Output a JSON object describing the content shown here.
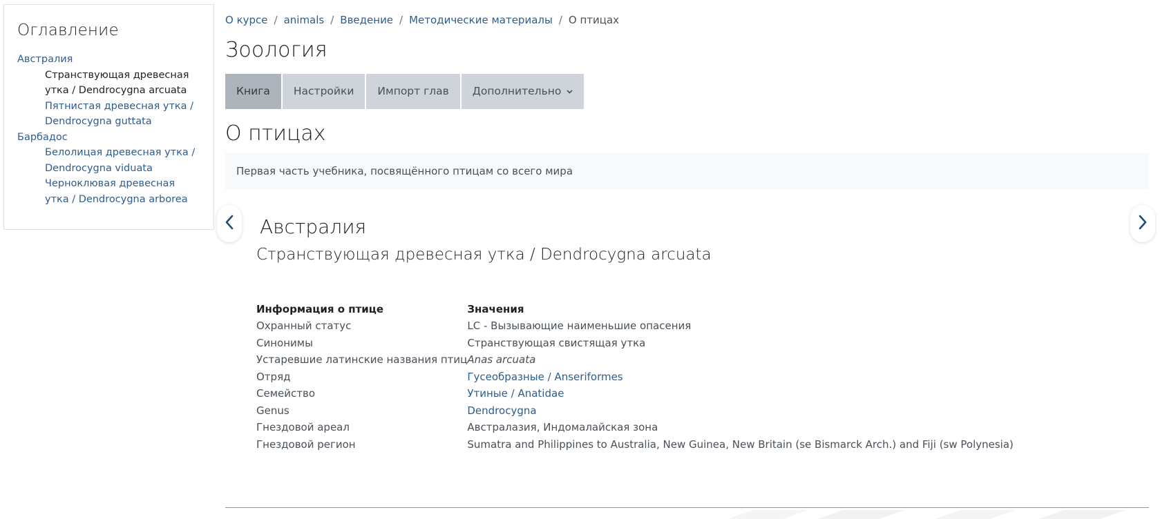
{
  "toc": {
    "title": "Оглавление",
    "chapters": [
      {
        "label": "Австралия",
        "subchapters": [
          {
            "label": "Странствующая древесная утка / Dendrocygna arcuata",
            "current": true
          },
          {
            "label": "Пятнистая древесная утка / Dendrocygna guttata",
            "current": false
          }
        ]
      },
      {
        "label": "Барбадос",
        "subchapters": [
          {
            "label": "Белолицая древесная утка / Dendrocygna viduata",
            "current": false
          },
          {
            "label": "Черноклювая древесная утка / Dendrocygna arborea",
            "current": false
          }
        ]
      }
    ]
  },
  "breadcrumb": [
    "О курсе",
    "animals",
    "Введение",
    "Методические материалы",
    "О птицах"
  ],
  "breadcrumb_separator": "/",
  "page_title": "Зоология",
  "tabs": [
    {
      "label": "Книга",
      "active": true
    },
    {
      "label": "Настройки",
      "active": false
    },
    {
      "label": "Импорт глав",
      "active": false
    },
    {
      "label": "Дополнительно",
      "active": false,
      "dropdown": true
    }
  ],
  "book": {
    "title": "О птицах",
    "intro": "Первая часть учебника, посвящённого птицам со всего мира"
  },
  "chapter": {
    "title": "Австралия",
    "subtitle": "Странствующая древесная утка / Dendrocygna arcuata"
  },
  "info_table": {
    "headers": [
      "Информация о птице",
      "Значения"
    ],
    "rows": [
      {
        "key": "Охранный статус",
        "value": "LC - Вызывающие наименьшие опасения",
        "link": false,
        "italic": false
      },
      {
        "key": "Синонимы",
        "value": "Странствующая свистящая утка",
        "link": false,
        "italic": false
      },
      {
        "key": "Устаревшие латинские названия птиц",
        "value": "Anas arcuata",
        "link": false,
        "italic": true
      },
      {
        "key": "Отряд",
        "value": "Гусеобразные / Anseriformes",
        "link": true,
        "italic": false
      },
      {
        "key": "Семейство",
        "value": "Утиные / Anatidae",
        "link": true,
        "italic": false
      },
      {
        "key": "Genus",
        "value": "Dendrocygna",
        "link": true,
        "italic": false
      },
      {
        "key": "Гнездовой ареал",
        "value": "Австралазия, Индомалайская зона",
        "link": false,
        "italic": false
      },
      {
        "key": "Гнездовой регион",
        "value": "Sumatra and Philippines to Australia, New Guinea, New Britain (se Bismarck Arch.) and Fiji (sw Polynesia)",
        "link": false,
        "italic": false
      }
    ]
  },
  "icons": {
    "prev": "chevron-left-icon",
    "next": "chevron-right-icon",
    "dropdown": "chevron-down-icon"
  },
  "colors": {
    "link": "#2f5c8f",
    "tab_bg": "#ced4da",
    "tab_active_bg": "#aeb4bb"
  }
}
